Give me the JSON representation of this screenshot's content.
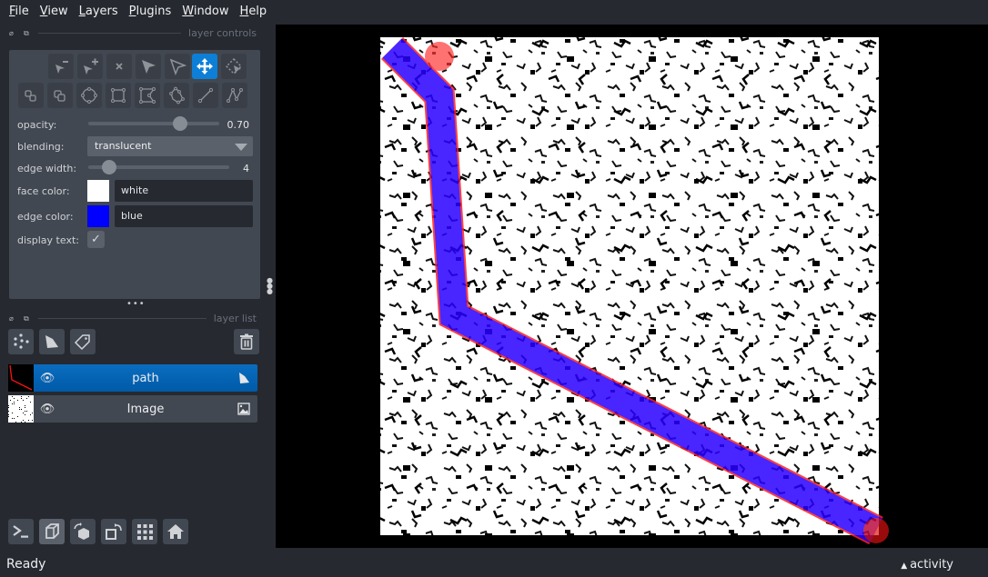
{
  "menu": [
    "File",
    "View",
    "Layers",
    "Plugins",
    "Window",
    "Help"
  ],
  "menu_mnemonics": [
    "F",
    "V",
    "L",
    "P",
    "W",
    "H"
  ],
  "layer_controls": {
    "title": "layer controls",
    "tools_row1": [
      "remove-points",
      "add-points",
      "delete-selected",
      "select-vertices",
      "select-shapes",
      "pan-zoom",
      "transform"
    ],
    "tools_row2": [
      "move-to-back",
      "move-to-front",
      "add-ellipses",
      "add-rectangles",
      "add-polygons",
      "add-polygon-lasso",
      "add-lines",
      "add-paths"
    ],
    "active_tool": "pan-zoom",
    "opacity_label": "opacity:",
    "opacity_value": "0.70",
    "opacity_fraction": 0.7,
    "blending_label": "blending:",
    "blending_value": "translucent",
    "edge_width_label": "edge width:",
    "edge_width_value": "4",
    "edge_width_fraction": 0.15,
    "face_color_label": "face color:",
    "face_color_value": "white",
    "face_color_hex": "#ffffff",
    "edge_color_label": "edge color:",
    "edge_color_value": "blue",
    "edge_color_hex": "#0000ff",
    "display_text_label": "display text:",
    "display_text_checked": true
  },
  "layer_list": {
    "title": "layer list",
    "layers": [
      {
        "name": "path",
        "type": "shapes",
        "selected": true,
        "visible": true
      },
      {
        "name": "Image",
        "type": "image",
        "selected": false,
        "visible": true
      }
    ]
  },
  "status": {
    "text": "Ready",
    "activity_label": "activity"
  },
  "colors": {
    "accent": "#0d7fd7",
    "path_edge": "#0000ff",
    "path_highlight": "#ff0000"
  }
}
